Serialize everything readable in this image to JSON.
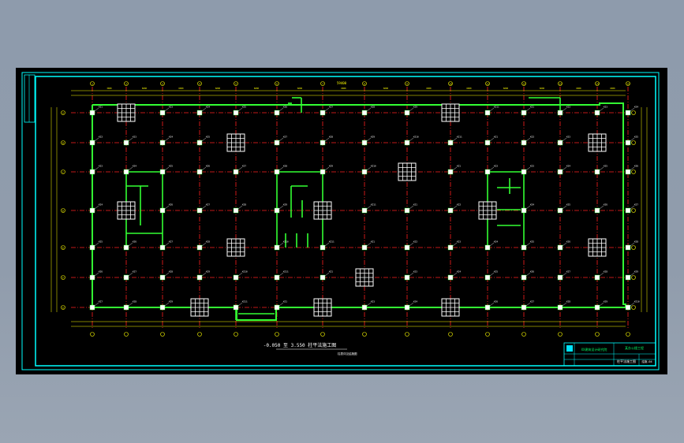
{
  "drawing": {
    "plan_title": "-0.050 至 3.550 柱平法施工图",
    "plan_note": "柱表详见结施图",
    "overall_dimension": "59400",
    "colors": {
      "background": "#000000",
      "frame": "#00ffff",
      "grid_line": "#ff2020",
      "wall": "#33ff33",
      "column": "#ffffff",
      "dimension": "#ffff00",
      "tag": "#ffffff"
    },
    "column_grid": {
      "x_axis_labels": [
        "1",
        "2",
        "3",
        "4",
        "5",
        "6",
        "7",
        "8",
        "9",
        "10",
        "11",
        "12",
        "13",
        "14",
        "15",
        "16",
        "17",
        "18",
        "19",
        "20"
      ],
      "y_axis_labels": [
        "A",
        "B",
        "C",
        "D",
        "E",
        "F",
        "G"
      ],
      "bay_dimensions": [
        "3000",
        "6000",
        "6000",
        "6000",
        "6000",
        "6000",
        "6000",
        "6000",
        "6000",
        "6000",
        "6000",
        "6000",
        "6000",
        "6000",
        "6000",
        "3000"
      ]
    },
    "column_tags": [
      "KZ1",
      "KZ2",
      "KZ3",
      "KZ4",
      "KZ5",
      "KZ6",
      "KZ7",
      "KZ8",
      "KZ9",
      "KZ10",
      "KZ11"
    ],
    "title_block": {
      "company": "XX建筑设计研究院",
      "project": "某办公楼工程",
      "sheet_name": "柱平法施工图",
      "sheet_number": "结施-04"
    }
  }
}
